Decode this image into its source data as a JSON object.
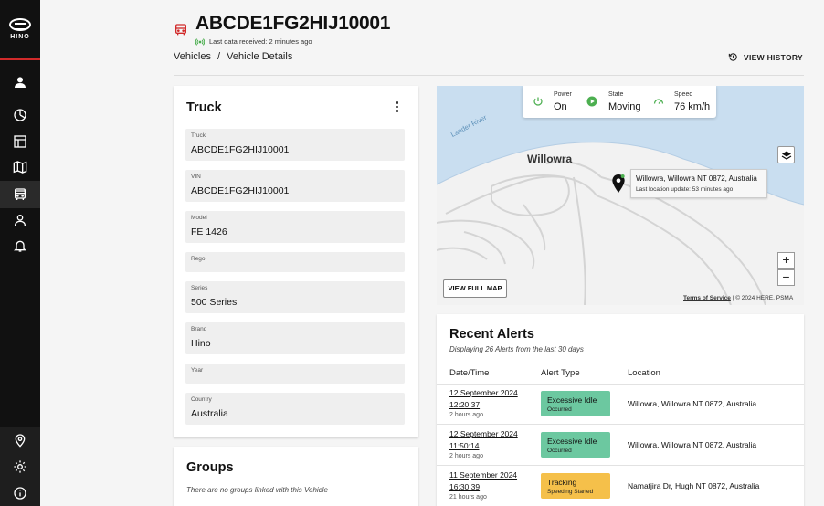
{
  "brand": {
    "logo_text": "HINO",
    "accent": "#d12a2a"
  },
  "sidebar": {
    "items": [
      {
        "icon": "user-icon"
      },
      {
        "icon": "dashboard-icon"
      },
      {
        "icon": "reports-icon"
      },
      {
        "icon": "map-icon"
      },
      {
        "icon": "bus-icon",
        "active": true
      },
      {
        "icon": "driver-icon"
      },
      {
        "icon": "bell-icon"
      }
    ],
    "bottom_items": [
      {
        "icon": "location-icon"
      },
      {
        "icon": "gear-icon"
      },
      {
        "icon": "info-icon"
      }
    ]
  },
  "header": {
    "title": "ABCDE1FG2HIJ10001",
    "last_data": "Last data received: 2 minutes ago",
    "breadcrumb": [
      "Vehicles",
      "/",
      "Vehicle Details"
    ],
    "view_history_label": "VIEW HISTORY"
  },
  "truck_card": {
    "title": "Truck",
    "fields": [
      {
        "label": "Truck",
        "value": "ABCDE1FG2HIJ10001"
      },
      {
        "label": "VIN",
        "value": "ABCDE1FG2HIJ10001"
      },
      {
        "label": "Model",
        "value": "FE 1426"
      },
      {
        "label": "Rego",
        "value": ""
      },
      {
        "label": "Series",
        "value": "500 Series"
      },
      {
        "label": "Brand",
        "value": "Hino"
      },
      {
        "label": "Year",
        "value": ""
      },
      {
        "label": "Country",
        "value": "Australia"
      }
    ]
  },
  "groups_card": {
    "title": "Groups",
    "empty_text": "There are no groups linked with this Vehicle"
  },
  "map": {
    "status": [
      {
        "label": "Power",
        "value": "On",
        "icon": "power-icon",
        "color": "#4caf50"
      },
      {
        "label": "State",
        "value": "Moving",
        "icon": "play-icon",
        "color": "#4caf50"
      },
      {
        "label": "Speed",
        "value": "76 km/h",
        "icon": "speedometer-icon",
        "color": "#4caf50"
      }
    ],
    "town_label": "Willowra",
    "river_label": "Lander River",
    "location_address": "Willowra, Willowra NT 0872, Australia",
    "location_update": "Last location update: 53 minutes ago",
    "view_full_map_label": "VIEW FULL MAP",
    "zoom_in": "+",
    "zoom_out": "−",
    "attribution_link": "Terms of Service",
    "attribution_text": " | © 2024 HERE, PSMA",
    "water_color": "#c9def0"
  },
  "alerts": {
    "title": "Recent Alerts",
    "subtitle": "Displaying 26 Alerts from the last 30 days",
    "columns": [
      "Date/Time",
      "Alert Type",
      "Location"
    ],
    "rows": [
      {
        "date": "12 September 2024",
        "time": "12:20:37",
        "ago": "2 hours ago",
        "type": "Excessive Idle",
        "status": "Occurred",
        "color": "#6cc8a0",
        "location": "Willowra, Willowra NT 0872, Australia"
      },
      {
        "date": "12 September 2024",
        "time": "11:50:14",
        "ago": "2 hours ago",
        "type": "Excessive Idle",
        "status": "Occurred",
        "color": "#6cc8a0",
        "location": "Willowra, Willowra NT 0872, Australia"
      },
      {
        "date": "11 September 2024",
        "time": "16:30:39",
        "ago": "21 hours ago",
        "type": "Tracking",
        "status": "Speeding Started",
        "color": "#f5c04a",
        "location": "Namatjira Dr, Hugh NT 0872, Australia"
      }
    ]
  }
}
